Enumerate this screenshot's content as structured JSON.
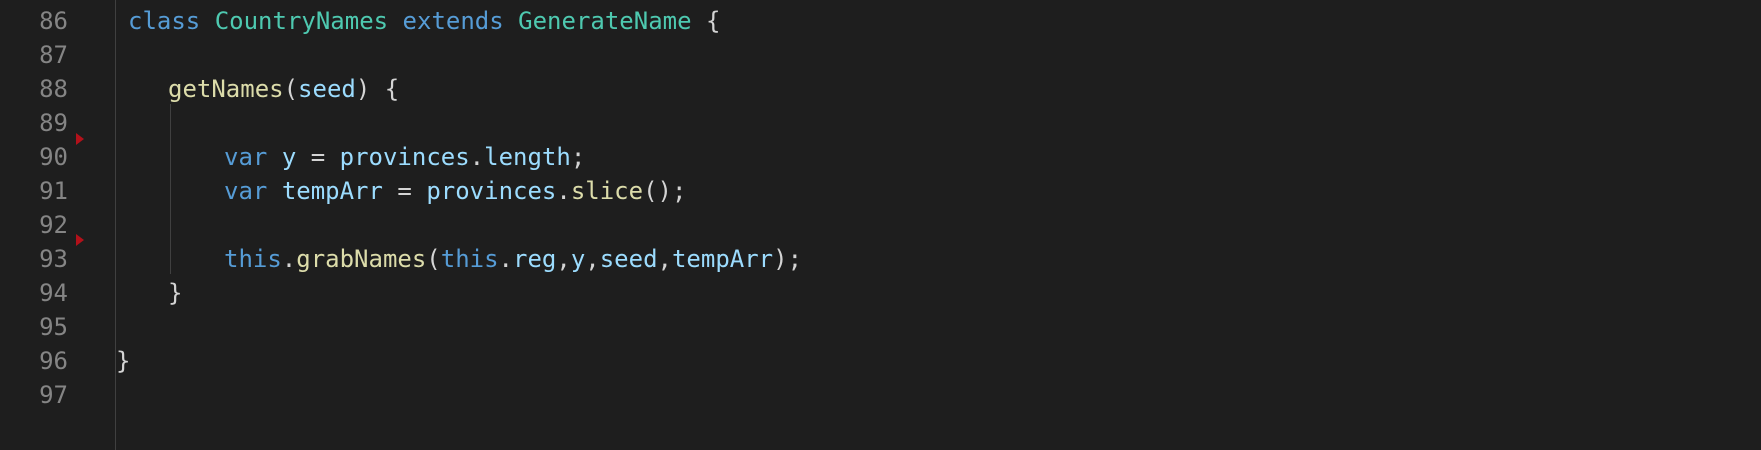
{
  "colors": {
    "background": "#1e1e1e",
    "line_number": "#858585",
    "keyword": "#569cd6",
    "type": "#4ec9b0",
    "function": "#dcdcaa",
    "variable": "#9cdcfe",
    "punctuation": "#d4d4d4",
    "marker": "#b3111a"
  },
  "editor": {
    "line_numbers": [
      "86",
      "87",
      "88",
      "89",
      "90",
      "91",
      "92",
      "93",
      "94",
      "95",
      "96",
      "97"
    ],
    "lines": [
      {
        "number": "86",
        "tokens": [
          {
            "text": "class",
            "kind": "keyword"
          },
          {
            "text": " ",
            "kind": "punctuation"
          },
          {
            "text": "CountryNames",
            "kind": "type"
          },
          {
            "text": " ",
            "kind": "punctuation"
          },
          {
            "text": "extends",
            "kind": "keyword"
          },
          {
            "text": " ",
            "kind": "punctuation"
          },
          {
            "text": "GenerateName",
            "kind": "type"
          },
          {
            "text": " {",
            "kind": "punctuation"
          }
        ]
      },
      {
        "number": "87",
        "tokens": []
      },
      {
        "number": "88",
        "tokens": [
          {
            "text": "getNames",
            "kind": "function"
          },
          {
            "text": "(",
            "kind": "punctuation"
          },
          {
            "text": "seed",
            "kind": "variable"
          },
          {
            "text": ") {",
            "kind": "punctuation"
          }
        ]
      },
      {
        "number": "89",
        "tokens": []
      },
      {
        "number": "90",
        "tokens": [
          {
            "text": "var",
            "kind": "keyword"
          },
          {
            "text": " ",
            "kind": "punctuation"
          },
          {
            "text": "y",
            "kind": "variable"
          },
          {
            "text": " = ",
            "kind": "punctuation"
          },
          {
            "text": "provinces",
            "kind": "variable"
          },
          {
            "text": ".",
            "kind": "punctuation"
          },
          {
            "text": "length",
            "kind": "variable"
          },
          {
            "text": ";",
            "kind": "punctuation"
          }
        ]
      },
      {
        "number": "91",
        "tokens": [
          {
            "text": "var",
            "kind": "keyword"
          },
          {
            "text": " ",
            "kind": "punctuation"
          },
          {
            "text": "tempArr",
            "kind": "variable"
          },
          {
            "text": " = ",
            "kind": "punctuation"
          },
          {
            "text": "provinces",
            "kind": "variable"
          },
          {
            "text": ".",
            "kind": "punctuation"
          },
          {
            "text": "slice",
            "kind": "function"
          },
          {
            "text": "();",
            "kind": "punctuation"
          }
        ]
      },
      {
        "number": "92",
        "tokens": []
      },
      {
        "number": "93",
        "tokens": [
          {
            "text": "this",
            "kind": "keyword"
          },
          {
            "text": ".",
            "kind": "punctuation"
          },
          {
            "text": "grabNames",
            "kind": "function"
          },
          {
            "text": "(",
            "kind": "punctuation"
          },
          {
            "text": "this",
            "kind": "keyword"
          },
          {
            "text": ".",
            "kind": "punctuation"
          },
          {
            "text": "reg",
            "kind": "variable"
          },
          {
            "text": ",",
            "kind": "punctuation"
          },
          {
            "text": "y",
            "kind": "variable"
          },
          {
            "text": ",",
            "kind": "punctuation"
          },
          {
            "text": "seed",
            "kind": "variable"
          },
          {
            "text": ",",
            "kind": "punctuation"
          },
          {
            "text": "tempArr",
            "kind": "variable"
          },
          {
            "text": ");",
            "kind": "punctuation"
          }
        ]
      },
      {
        "number": "94",
        "tokens": [
          {
            "text": "}",
            "kind": "punctuation"
          }
        ]
      },
      {
        "number": "95",
        "tokens": []
      },
      {
        "number": "96",
        "tokens": [
          {
            "text": "}",
            "kind": "punctuation"
          }
        ]
      },
      {
        "number": "97",
        "tokens": []
      }
    ]
  }
}
